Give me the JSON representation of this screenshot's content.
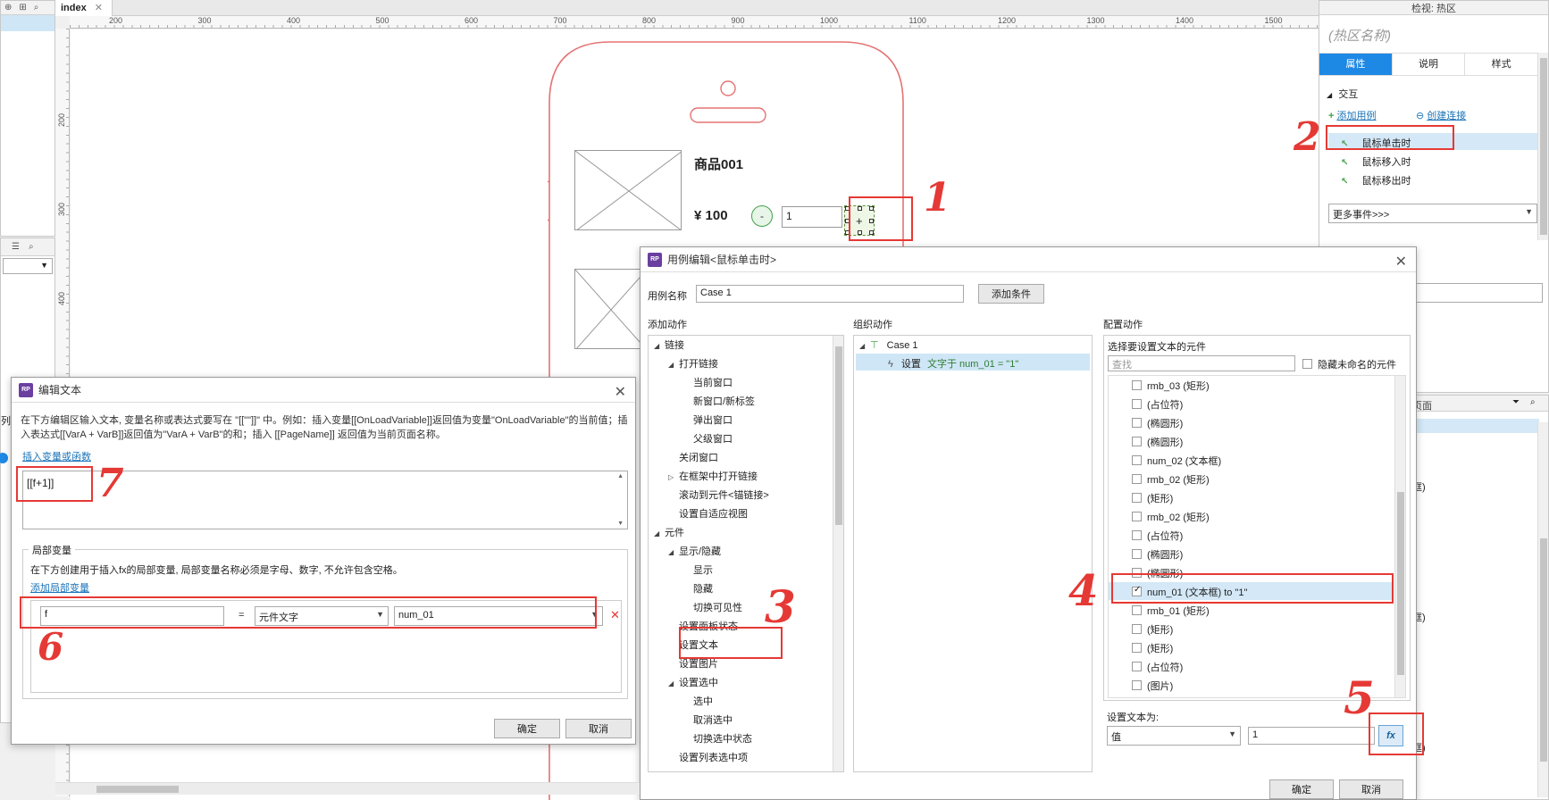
{
  "editor": {
    "tab_label": "index",
    "ruler_ticks_h": [
      "200",
      "300",
      "400",
      "500",
      "600",
      "700",
      "800",
      "900",
      "1000",
      "1100",
      "1200",
      "1300",
      "1400",
      "1500"
    ],
    "ruler_ticks_v": [
      "200",
      "300",
      "400"
    ],
    "product_name": "商品001",
    "price": "¥ 100",
    "minus_label": "-",
    "qty_value": "1",
    "plus_label": "+"
  },
  "right_panel": {
    "header": "检视: 热区",
    "name_placeholder": "(热区名称)",
    "tabs": [
      "属性",
      "说明",
      "样式"
    ],
    "section_interaction": "交互",
    "add_case": "添加用例",
    "create_link": "创建连接",
    "events": [
      "鼠标单击时",
      "鼠标移入时",
      "鼠标移出时"
    ],
    "more_events": "更多事件>>>",
    "outline_header": "概要: 页面",
    "side_labels": [
      "框)",
      "框)",
      "框)"
    ]
  },
  "case_dialog": {
    "title": "用例编辑<鼠标单击时>",
    "case_name_label": "用例名称",
    "case_name_value": "Case 1",
    "add_condition": "添加条件",
    "col_add_action": "添加动作",
    "col_organize": "组织动作",
    "col_configure": "配置动作",
    "actions_tree": [
      {
        "label": "链接",
        "level": 0,
        "tri": "◢"
      },
      {
        "label": "打开链接",
        "level": 1,
        "tri": "◢"
      },
      {
        "label": "当前窗口",
        "level": 2,
        "tri": ""
      },
      {
        "label": "新窗口/新标签",
        "level": 2,
        "tri": ""
      },
      {
        "label": "弹出窗口",
        "level": 2,
        "tri": ""
      },
      {
        "label": "父级窗口",
        "level": 2,
        "tri": ""
      },
      {
        "label": "关闭窗口",
        "level": 1,
        "tri": ""
      },
      {
        "label": "在框架中打开链接",
        "level": 1,
        "tri": "▷"
      },
      {
        "label": "滚动到元件<锚链接>",
        "level": 1,
        "tri": ""
      },
      {
        "label": "设置自适应视图",
        "level": 1,
        "tri": ""
      },
      {
        "label": "元件",
        "level": 0,
        "tri": "◢"
      },
      {
        "label": "显示/隐藏",
        "level": 1,
        "tri": "◢"
      },
      {
        "label": "显示",
        "level": 2,
        "tri": ""
      },
      {
        "label": "隐藏",
        "level": 2,
        "tri": ""
      },
      {
        "label": "切换可见性",
        "level": 2,
        "tri": ""
      },
      {
        "label": "设置面板状态",
        "level": 1,
        "tri": ""
      },
      {
        "label": "设置文本",
        "level": 1,
        "tri": ""
      },
      {
        "label": "设置图片",
        "level": 1,
        "tri": ""
      },
      {
        "label": "设置选中",
        "level": 1,
        "tri": "◢"
      },
      {
        "label": "选中",
        "level": 2,
        "tri": ""
      },
      {
        "label": "取消选中",
        "level": 2,
        "tri": ""
      },
      {
        "label": "切换选中状态",
        "level": 2,
        "tri": ""
      },
      {
        "label": "设置列表选中项",
        "level": 1,
        "tri": ""
      }
    ],
    "case_node": "Case 1",
    "action_prefix": "设置",
    "action_text": "文字于 num_01 = \"1\"",
    "select_widgets_label": "选择要设置文本的元件",
    "search_placeholder": "查找",
    "hide_unnamed": "隐藏未命名的元件",
    "widgets": [
      {
        "label": "rmb_03 (矩形)",
        "checked": false
      },
      {
        "label": "(占位符)",
        "checked": false
      },
      {
        "label": "(椭圆形)",
        "checked": false
      },
      {
        "label": "(椭圆形)",
        "checked": false
      },
      {
        "label": "num_02 (文本框)",
        "checked": false
      },
      {
        "label": "rmb_02 (矩形)",
        "checked": false
      },
      {
        "label": "(矩形)",
        "checked": false
      },
      {
        "label": "rmb_02 (矩形)",
        "checked": false
      },
      {
        "label": "(占位符)",
        "checked": false
      },
      {
        "label": "(椭圆形)",
        "checked": false
      },
      {
        "label": "(椭圆形)",
        "checked": false
      },
      {
        "label": "num_01 (文本框) to \"1\"",
        "checked": true
      },
      {
        "label": "rmb_01 (矩形)",
        "checked": false
      },
      {
        "label": "(矩形)",
        "checked": false
      },
      {
        "label": "(矩形)",
        "checked": false
      },
      {
        "label": "(占位符)",
        "checked": false
      },
      {
        "label": "(图片)",
        "checked": false
      }
    ],
    "set_text_label": "设置文本为:",
    "set_text_type": "值",
    "set_text_value": "1",
    "fx_label": "fx",
    "ok": "确定",
    "cancel": "取消"
  },
  "edit_text_dialog": {
    "title": "编辑文本",
    "description": "在下方编辑区输入文本, 变量名称或表达式要写在 \"[[\"\"]]\" 中。例如：插入变量[[OnLoadVariable]]返回值为变量\"OnLoadVariable\"的当前值；插入表达式[[VarA + VarB]]返回值为\"VarA + VarB\"的和；插入 [[PageName]] 返回值为当前页面名称。",
    "insert_var_link": "插入变量或函数",
    "expression": "[[f+1]]",
    "local_vars_title": "局部变量",
    "local_vars_desc": "在下方创建用于插入fx的局部变量, 局部变量名称必须是字母、数字, 不允许包含空格。",
    "add_local_var": "添加局部变量",
    "var_name": "f",
    "equals": "=",
    "var_type": "元件文字",
    "var_target": "num_01",
    "ok": "确定",
    "cancel": "取消"
  },
  "left_panel": {
    "side_label": "列"
  },
  "annotations": [
    "1",
    "2",
    "3",
    "4",
    "5",
    "6",
    "7"
  ],
  "colors": {
    "annotation_red": "#e53935",
    "tab_active": "#1e88e5",
    "phone_outline": "#e57373",
    "green_minus": "#43a047",
    "link_blue": "#1a73b8"
  }
}
